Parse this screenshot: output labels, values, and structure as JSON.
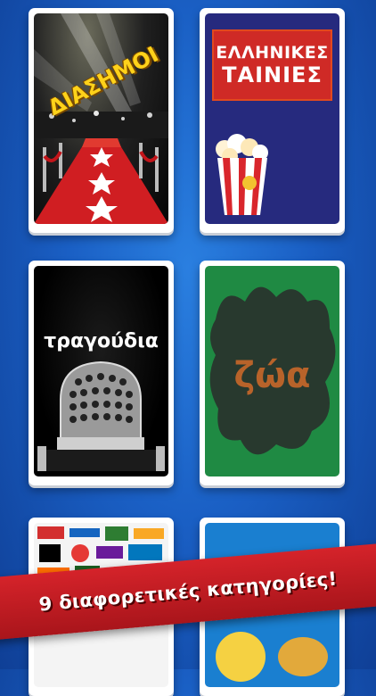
{
  "categories": [
    {
      "title": "ΔΙΑΣΗΜΟΙ"
    },
    {
      "title_line1": "ΕΛΛΗΝΙΚΕΣ",
      "title_line2": "ΤΑΙΝΙΕΣ"
    },
    {
      "title": "τραγούδια"
    },
    {
      "title": "ζώα"
    },
    {
      "title": ""
    },
    {
      "title": ""
    }
  ],
  "banner": {
    "text": "9 διαφορετικές κατηγορίες!"
  },
  "colors": {
    "background": "#1a5fc4",
    "banner": "#d5232a",
    "movies_card": "#262a7e",
    "animals_card": "#1f8a43"
  }
}
